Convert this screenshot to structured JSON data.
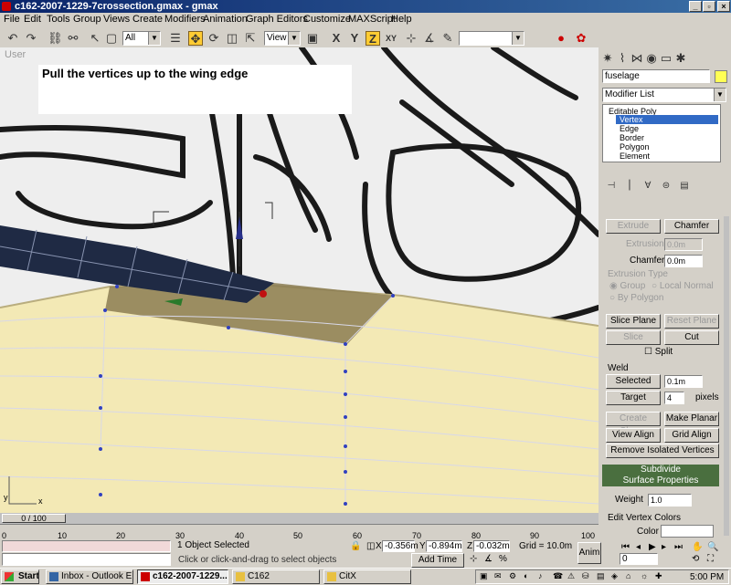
{
  "window": {
    "title": "c162-2007-1229-7crossection.gmax - gmax"
  },
  "menu": [
    "File",
    "Edit",
    "Tools",
    "Group",
    "Views",
    "Create",
    "Modifiers",
    "Animation",
    "Graph Editors",
    "Customize",
    "MAXScript",
    "Help"
  ],
  "toolbar": {
    "selection_filter": "All",
    "reference_coord": "View",
    "axis_buttons": [
      "X",
      "Y",
      "Z",
      "XY"
    ]
  },
  "viewport": {
    "label": "User",
    "note": "Pull the vertices up to the wing edge"
  },
  "timeline": {
    "frame_indicator": "0 / 100",
    "ticks": [
      "0",
      "10",
      "20",
      "30",
      "40",
      "50",
      "60",
      "70",
      "80",
      "90",
      "100"
    ]
  },
  "status": {
    "selected": "1 Object Selected",
    "prompt": "Click or click-and-drag to select objects",
    "x_label": "X",
    "x": "-0.356m",
    "y_label": "Y",
    "y": "-0.894m",
    "z_label": "Z",
    "z": "-0.032m",
    "grid": "Grid = 10.0m",
    "add_time_tag": "Add Time Tag",
    "anim": "Anim",
    "frame": "0"
  },
  "panel": {
    "object_name": "fuselage",
    "modifier_list": "Modifier List",
    "stack": [
      "Editable Poly",
      "Vertex",
      "Edge",
      "Border",
      "Polygon",
      "Element"
    ],
    "extrude": "Extrude",
    "chamfer": "Chamfer",
    "extrusion_label": "Extrusion",
    "extrusion_value": "0.0m",
    "chamfer_label": "Chamfer",
    "chamfer_value": "0.0m",
    "extrusion_type": "Extrusion Type",
    "group": "Group",
    "local_normal": "Local Normal",
    "by_polygon": "By Polygon",
    "slice_plane": "Slice Plane",
    "reset_plane": "Reset Plane",
    "slice": "Slice",
    "cut": "Cut",
    "split": "Split",
    "weld": "Weld",
    "selected": "Selected",
    "selected_value": "0.1m",
    "target": "Target",
    "target_value": "4",
    "pixels": "pixels",
    "create_shape": "Create Shape",
    "make_planar": "Make Planar",
    "view_align": "View Align",
    "grid_align": "Grid Align",
    "remove_isolated": "Remove Isolated Vertices",
    "subdivide": "Subdivide",
    "surface_properties": "Surface Properties",
    "weight_label": "Weight",
    "weight_value": "1.0",
    "edit_vertex_colors": "Edit Vertex Colors",
    "color_label": "Color"
  },
  "taskbar": {
    "start": "Start",
    "tasks": [
      "Inbox - Outlook E...",
      "c162-2007-1229...",
      "C162",
      "CitX"
    ],
    "clock": "5:00 PM"
  },
  "colors": {
    "accent": "#316ac5",
    "titlebar": "#0a246a",
    "rollout": "#4a6f3f",
    "fuselage": "#f3e9b5",
    "wing": "#1f2a44"
  }
}
